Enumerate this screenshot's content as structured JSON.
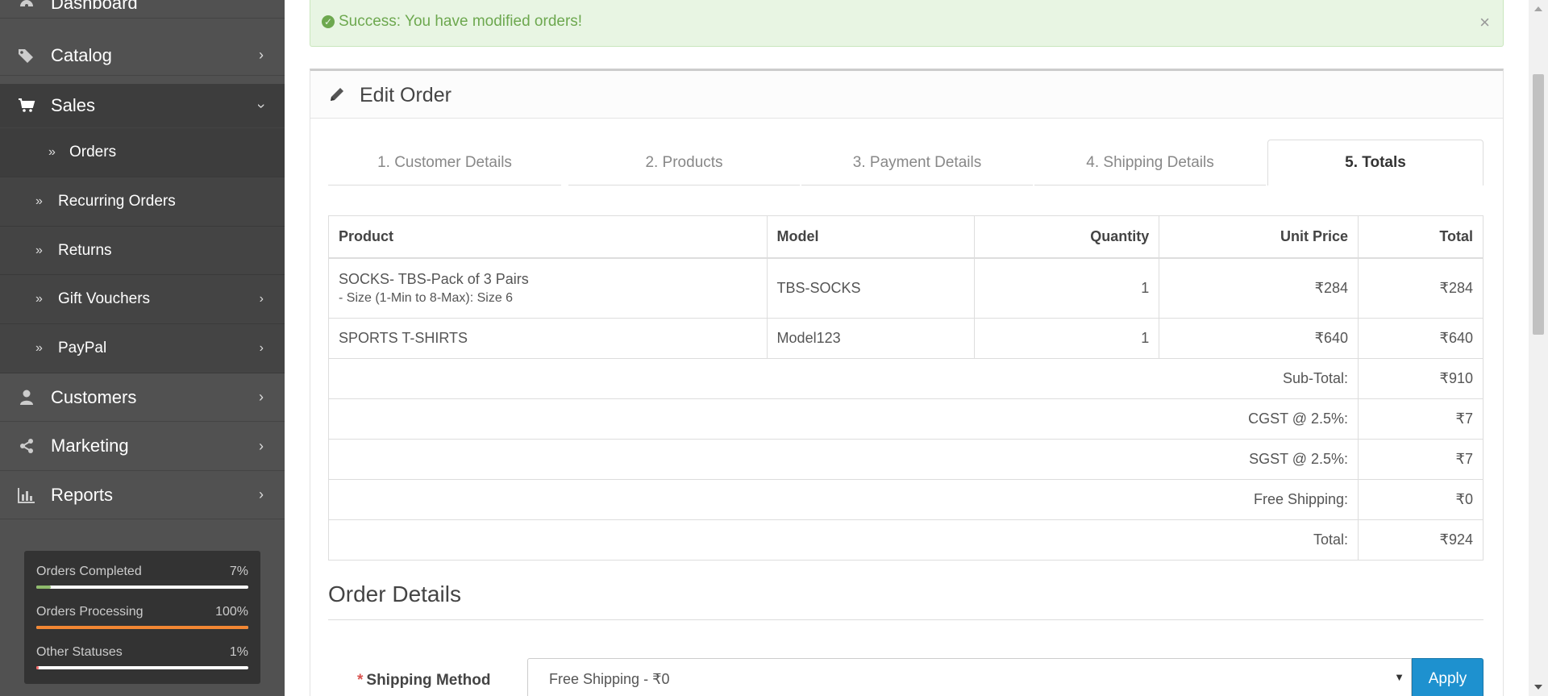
{
  "sidebar": {
    "items": [
      {
        "label": "Dashboard",
        "icon": "dashboard-icon"
      },
      {
        "label": "Catalog",
        "icon": "tags-icon"
      },
      {
        "label": "Sales",
        "icon": "cart-icon"
      },
      {
        "label": "Customers",
        "icon": "user-icon"
      },
      {
        "label": "Marketing",
        "icon": "share-icon"
      },
      {
        "label": "Reports",
        "icon": "bar-chart-icon"
      }
    ],
    "sales_sub": [
      {
        "label": "Orders"
      },
      {
        "label": "Recurring Orders"
      },
      {
        "label": "Returns"
      },
      {
        "label": "Gift Vouchers"
      },
      {
        "label": "PayPal"
      }
    ],
    "stats": [
      {
        "name": "Orders Completed",
        "pct": "7%",
        "value": 0.07,
        "color": "#8fbb6c"
      },
      {
        "name": "Orders Processing",
        "pct": "100%",
        "value": 1.0,
        "color": "#f38733"
      },
      {
        "name": "Other Statuses",
        "pct": "1%",
        "value": 0.01,
        "color": "#f56b6b"
      }
    ]
  },
  "alert": {
    "message": "Success: You have modified orders!",
    "close": "×"
  },
  "panel": {
    "title": "Edit Order"
  },
  "tabs": [
    {
      "label": "1. Customer Details"
    },
    {
      "label": "2. Products"
    },
    {
      "label": "3. Payment Details"
    },
    {
      "label": "4. Shipping Details"
    },
    {
      "label": "5. Totals"
    }
  ],
  "table": {
    "headers": {
      "product": "Product",
      "model": "Model",
      "quantity": "Quantity",
      "unit_price": "Unit Price",
      "total": "Total"
    },
    "rows": [
      {
        "product": "SOCKS- TBS-Pack of 3 Pairs",
        "option": "- Size (1-Min to 8-Max): Size 6",
        "model": "TBS-SOCKS",
        "quantity": "1",
        "unit_price": "₹284",
        "total": "₹284"
      },
      {
        "product": "SPORTS T-SHIRTS",
        "model": "Model123",
        "quantity": "1",
        "unit_price": "₹640",
        "total": "₹640"
      }
    ],
    "totals": [
      {
        "label": "Sub-Total:",
        "value": "₹910"
      },
      {
        "label": "CGST @ 2.5%:",
        "value": "₹7"
      },
      {
        "label": "SGST @ 2.5%:",
        "value": "₹7"
      },
      {
        "label": "Free Shipping:",
        "value": "₹0"
      },
      {
        "label": "Total:",
        "value": "₹924"
      }
    ]
  },
  "order_details": {
    "title": "Order Details",
    "shipping_label": "Shipping Method",
    "required_mark": "*",
    "shipping_value": "Free Shipping - ₹0",
    "apply_label": "Apply"
  }
}
